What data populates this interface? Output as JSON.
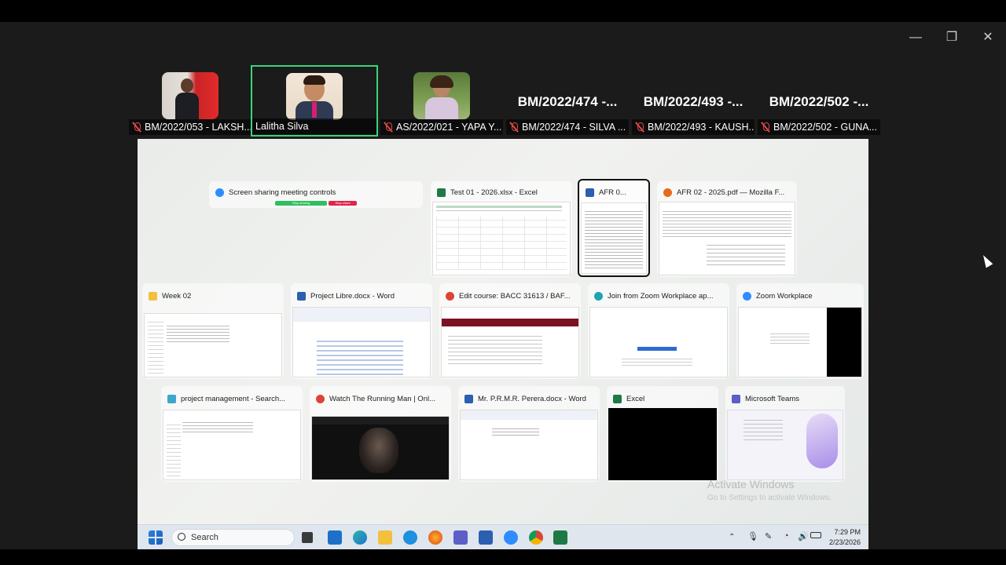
{
  "participants": [
    {
      "label": "BM/2022/053 - LAKSH...",
      "muted": true
    },
    {
      "label": "Lalitha Silva",
      "muted": false
    },
    {
      "label": "AS/2022/021 - YAPA Y...",
      "muted": true
    },
    {
      "label": "BM/2022/474 - SILVA ...",
      "muted": true,
      "big_name": "BM/2022/474  -..."
    },
    {
      "label": "BM/2022/493 - KAUSH...",
      "muted": true,
      "big_name": "BM/2022/493  -..."
    },
    {
      "label": "BM/2022/502 - GUNA...",
      "muted": true,
      "big_name": "BM/2022/502  -..."
    }
  ],
  "windows": {
    "row1": [
      {
        "title": "Screen sharing meeting controls",
        "icon": "zoom-icon",
        "buttons": [
          "Stop sharing",
          "Stop share"
        ]
      },
      {
        "title": "Test 01 - 2026.xlsx - Excel",
        "icon": "excel-icon"
      },
      {
        "title": "AFR 0...",
        "icon": "word-icon"
      },
      {
        "title": "AFR 02 - 2025.pdf — Mozilla F...",
        "icon": "firefox-icon"
      }
    ],
    "row2": [
      {
        "title": "Week 02",
        "icon": "folder-icon"
      },
      {
        "title": "Project Libre.docx - Word",
        "icon": "word-icon"
      },
      {
        "title": "Edit course: BACC 31613 / BAF...",
        "icon": "chrome-icon"
      },
      {
        "title": "Join from Zoom Workplace ap...",
        "icon": "edge-icon"
      },
      {
        "title": "Zoom Workplace",
        "icon": "zoom-icon"
      }
    ],
    "row3": [
      {
        "title": "project management - Search...",
        "icon": "search-app-icon"
      },
      {
        "title": "Watch The Running Man | Onl...",
        "icon": "chrome-icon"
      },
      {
        "title": "Mr. P.R.M.R. Perera.docx - Word",
        "icon": "word-icon"
      },
      {
        "title": "Excel",
        "icon": "excel-icon"
      },
      {
        "title": "Microsoft Teams",
        "icon": "teams-icon"
      }
    ]
  },
  "watermark": {
    "line1": "Activate Windows",
    "line2": "Go to Settings to activate Windows."
  },
  "taskbar": {
    "search_label": "Search",
    "time": "7:29 PM",
    "date": "2/23/2026"
  },
  "colors": {
    "active_speaker": "#3dd37a",
    "muted": "#e04848",
    "excel": "#1d7a44",
    "word": "#2b5faf",
    "zoom": "#2d8cff"
  }
}
